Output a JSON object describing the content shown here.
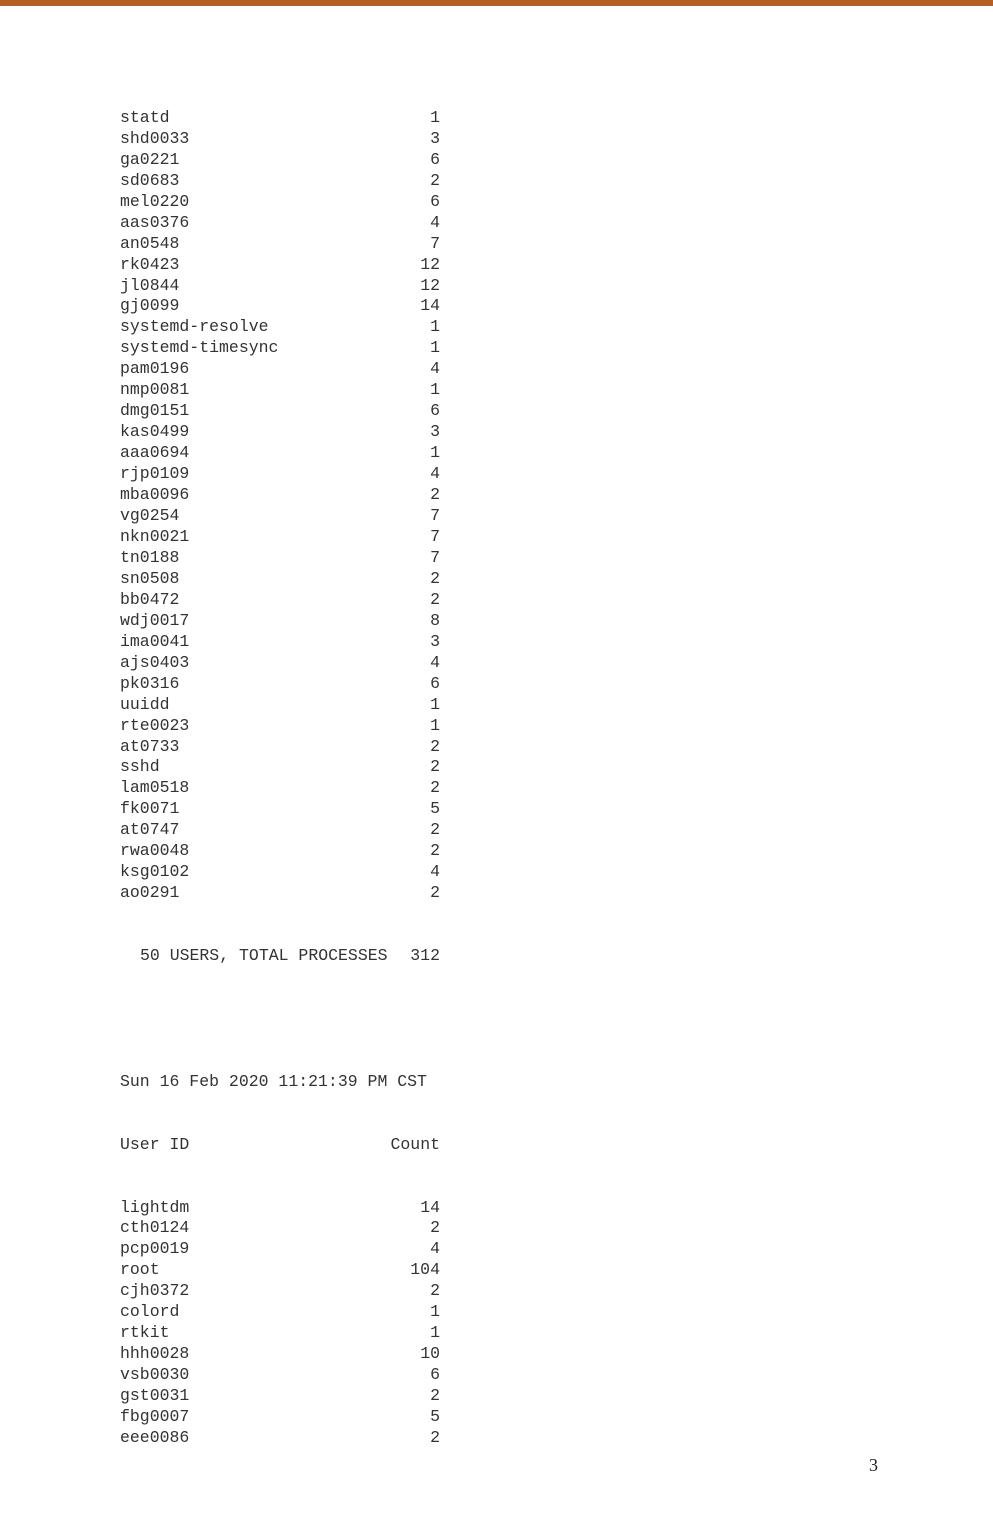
{
  "block1": {
    "rows": [
      {
        "user": "statd",
        "count": "1"
      },
      {
        "user": "shd0033",
        "count": "3"
      },
      {
        "user": "ga0221",
        "count": "6"
      },
      {
        "user": "sd0683",
        "count": "2"
      },
      {
        "user": "mel0220",
        "count": "6"
      },
      {
        "user": "aas0376",
        "count": "4"
      },
      {
        "user": "an0548",
        "count": "7"
      },
      {
        "user": "rk0423",
        "count": "12"
      },
      {
        "user": "jl0844",
        "count": "12"
      },
      {
        "user": "gj0099",
        "count": "14"
      },
      {
        "user": "systemd-resolve",
        "count": "1"
      },
      {
        "user": "systemd-timesync",
        "count": "1"
      },
      {
        "user": "pam0196",
        "count": "4"
      },
      {
        "user": "nmp0081",
        "count": "1"
      },
      {
        "user": "dmg0151",
        "count": "6"
      },
      {
        "user": "kas0499",
        "count": "3"
      },
      {
        "user": "aaa0694",
        "count": "1"
      },
      {
        "user": "rjp0109",
        "count": "4"
      },
      {
        "user": "mba0096",
        "count": "2"
      },
      {
        "user": "vg0254",
        "count": "7"
      },
      {
        "user": "nkn0021",
        "count": "7"
      },
      {
        "user": "tn0188",
        "count": "7"
      },
      {
        "user": "sn0508",
        "count": "2"
      },
      {
        "user": "bb0472",
        "count": "2"
      },
      {
        "user": "wdj0017",
        "count": "8"
      },
      {
        "user": "ima0041",
        "count": "3"
      },
      {
        "user": "ajs0403",
        "count": "4"
      },
      {
        "user": "pk0316",
        "count": "6"
      },
      {
        "user": "uuidd",
        "count": "1"
      },
      {
        "user": "rte0023",
        "count": "1"
      },
      {
        "user": "at0733",
        "count": "2"
      },
      {
        "user": "sshd",
        "count": "2"
      },
      {
        "user": "lam0518",
        "count": "2"
      },
      {
        "user": "fk0071",
        "count": "5"
      },
      {
        "user": "at0747",
        "count": "2"
      },
      {
        "user": "rwa0048",
        "count": "2"
      },
      {
        "user": "ksg0102",
        "count": "4"
      },
      {
        "user": "ao0291",
        "count": "2"
      }
    ],
    "summary_label": "50 USERS, TOTAL PROCESSES",
    "summary_total": "312"
  },
  "block2": {
    "timestamp": "Sun 16 Feb 2020 11:21:39 PM CST",
    "header_user": "User ID",
    "header_count": "Count",
    "rows": [
      {
        "user": "lightdm",
        "count": "14"
      },
      {
        "user": "cth0124",
        "count": "2"
      },
      {
        "user": "pcp0019",
        "count": "4"
      },
      {
        "user": "root",
        "count": "104"
      },
      {
        "user": "cjh0372",
        "count": "2"
      },
      {
        "user": "colord",
        "count": "1"
      },
      {
        "user": "rtkit",
        "count": "1"
      },
      {
        "user": "hhh0028",
        "count": "10"
      },
      {
        "user": "vsb0030",
        "count": "6"
      },
      {
        "user": "gst0031",
        "count": "2"
      },
      {
        "user": "fbg0007",
        "count": "5"
      },
      {
        "user": "eee0086",
        "count": "2"
      }
    ]
  },
  "page_number": "3"
}
